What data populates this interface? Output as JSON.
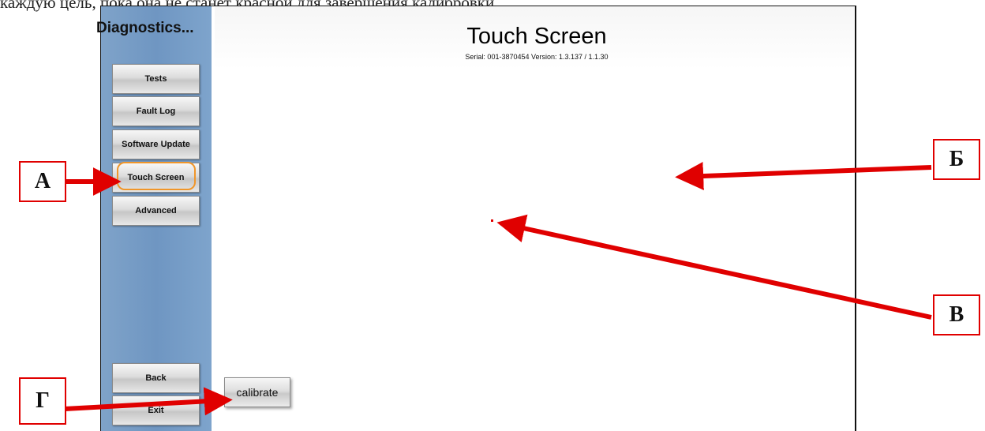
{
  "caption": "каждую цель, пока она не станет красной для завершения калибровки.",
  "sidebar": {
    "title": "Diagnostics...",
    "items": [
      {
        "label": "Tests"
      },
      {
        "label": "Fault Log"
      },
      {
        "label": "Software Update"
      },
      {
        "label": "Touch Screen",
        "active": true
      },
      {
        "label": "Advanced"
      }
    ],
    "bottom_items": [
      {
        "label": "Back"
      },
      {
        "label": "Exit"
      }
    ]
  },
  "main": {
    "title": "Touch Screen",
    "subtitle": "Serial: 001-3870454   Version: 1.3.137 / 1.1.30",
    "calibrate_label": "calibrate"
  },
  "annotations": {
    "a": "А",
    "b": "Б",
    "v": "В",
    "g": "Г",
    "color": "#e00000"
  },
  "colors": {
    "sidebar_bg": "#7399c4",
    "active_ring": "#f0962a"
  }
}
